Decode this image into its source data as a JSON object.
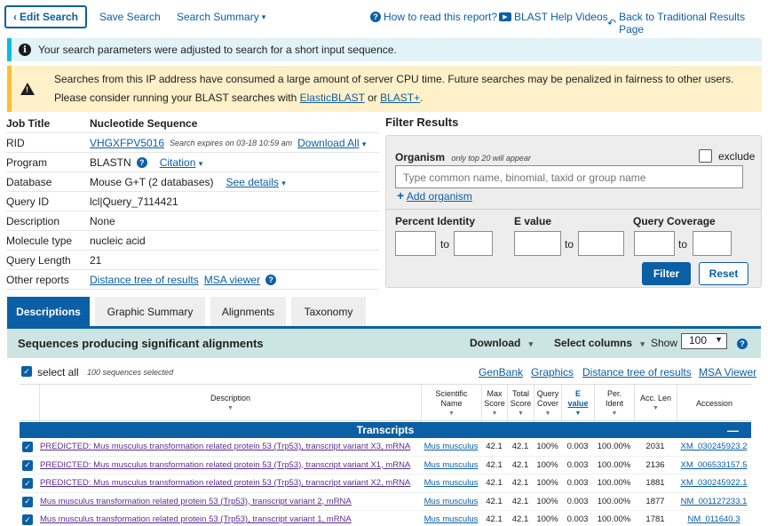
{
  "toolbar": {
    "edit_search": "Edit Search",
    "save_search": "Save Search",
    "search_summary": "Search Summary",
    "how_to_read": "How to read this report?",
    "help_videos": "BLAST Help Videos",
    "back_traditional": "Back to Traditional Results Page"
  },
  "info_banner": "Your search parameters were adjusted to search for a short input sequence.",
  "warning_banner": {
    "line1": "Searches from this IP address have consumed a large amount of server CPU time. Future searches may be penalized in fairness to other users.",
    "line2_prefix": "Please consider running your BLAST searches with",
    "link1": "ElasticBLAST",
    "or": "or",
    "link2": "BLAST+",
    "period": "."
  },
  "job": {
    "title_label": "Job Title",
    "title_value": "Nucleotide Sequence",
    "rid_label": "RID",
    "rid_value": "VHGXFPV5016",
    "rid_expires": "Search expires on 03-18 10:59 am",
    "download_all": "Download All",
    "program_label": "Program",
    "program_value": "BLASTN",
    "citation": "Citation",
    "database_label": "Database",
    "database_value": "Mouse G+T (2 databases)",
    "see_details": "See details",
    "query_id_label": "Query ID",
    "query_id_value": "lcl|Query_7114421",
    "description_label": "Description",
    "description_value": "None",
    "molecule_label": "Molecule type",
    "molecule_value": "nucleic acid",
    "query_length_label": "Query Length",
    "query_length_value": "21",
    "other_reports_label": "Other reports",
    "distance_tree": "Distance tree of results",
    "msa_viewer": "MSA viewer"
  },
  "filter": {
    "title": "Filter Results",
    "organism_label": "Organism",
    "organism_note": "only top 20 will appear",
    "exclude": "exclude",
    "organism_placeholder": "Type common  name, binomial, taxid or group  name",
    "add_organism": "Add organism",
    "percent_identity": "Percent Identity",
    "e_value": "E value",
    "query_coverage": "Query Coverage",
    "to": "to",
    "filter_btn": "Filter",
    "reset_btn": "Reset"
  },
  "tabs": [
    "Descriptions",
    "Graphic Summary",
    "Alignments",
    "Taxonomy"
  ],
  "results": {
    "title": "Sequences producing significant alignments",
    "download": "Download",
    "select_columns": "Select columns",
    "show": "Show",
    "show_value": "100",
    "select_all": "select all",
    "selected_count": "100 sequences selected",
    "links": [
      "GenBank",
      "Graphics",
      "Distance tree of results",
      "MSA Viewer"
    ]
  },
  "table": {
    "headers": {
      "description": "Description",
      "sci1": "Scientific",
      "sci2": "Name",
      "max1": "Max",
      "max2": "Score",
      "tot1": "Total",
      "tot2": "Score",
      "qc1": "Query",
      "qc2": "Cover",
      "e1": "E",
      "e2": "value",
      "pi1": "Per.",
      "pi2": "Ident",
      "acc1": "Acc. Len",
      "accession": "Accession"
    },
    "group": "Transcripts",
    "rows": [
      {
        "desc": "PREDICTED: Mus musculus transformation related protein 53 (Trp53), transcript variant X3, mRNA",
        "sci": "Mus musculus",
        "max": "42.1",
        "total": "42.1",
        "cover": "100%",
        "e": "0.003",
        "ident": "100.00%",
        "len": "2031",
        "acc": "XM_030245923.2"
      },
      {
        "desc": "PREDICTED: Mus musculus transformation related protein 53 (Trp53), transcript variant X1, mRNA",
        "sci": "Mus musculus",
        "max": "42.1",
        "total": "42.1",
        "cover": "100%",
        "e": "0.003",
        "ident": "100.00%",
        "len": "2136",
        "acc": "XM_006533157.5"
      },
      {
        "desc": "PREDICTED: Mus musculus transformation related protein 53 (Trp53), transcript variant X2, mRNA",
        "sci": "Mus musculus",
        "max": "42.1",
        "total": "42.1",
        "cover": "100%",
        "e": "0.003",
        "ident": "100.00%",
        "len": "1881",
        "acc": "XM_030245922.1"
      },
      {
        "desc": "Mus musculus transformation related protein 53 (Trp53), transcript variant 2, mRNA",
        "sci": "Mus musculus",
        "max": "42.1",
        "total": "42.1",
        "cover": "100%",
        "e": "0.003",
        "ident": "100.00%",
        "len": "1877",
        "acc": "NM_001127233.1"
      },
      {
        "desc": "Mus musculus transformation related protein 53 (Trp53), transcript variant 1, mRNA",
        "sci": "Mus musculus",
        "max": "42.1",
        "total": "42.1",
        "cover": "100%",
        "e": "0.003",
        "ident": "100.00%",
        "len": "1781",
        "acc": "NM_011640.3"
      }
    ]
  }
}
